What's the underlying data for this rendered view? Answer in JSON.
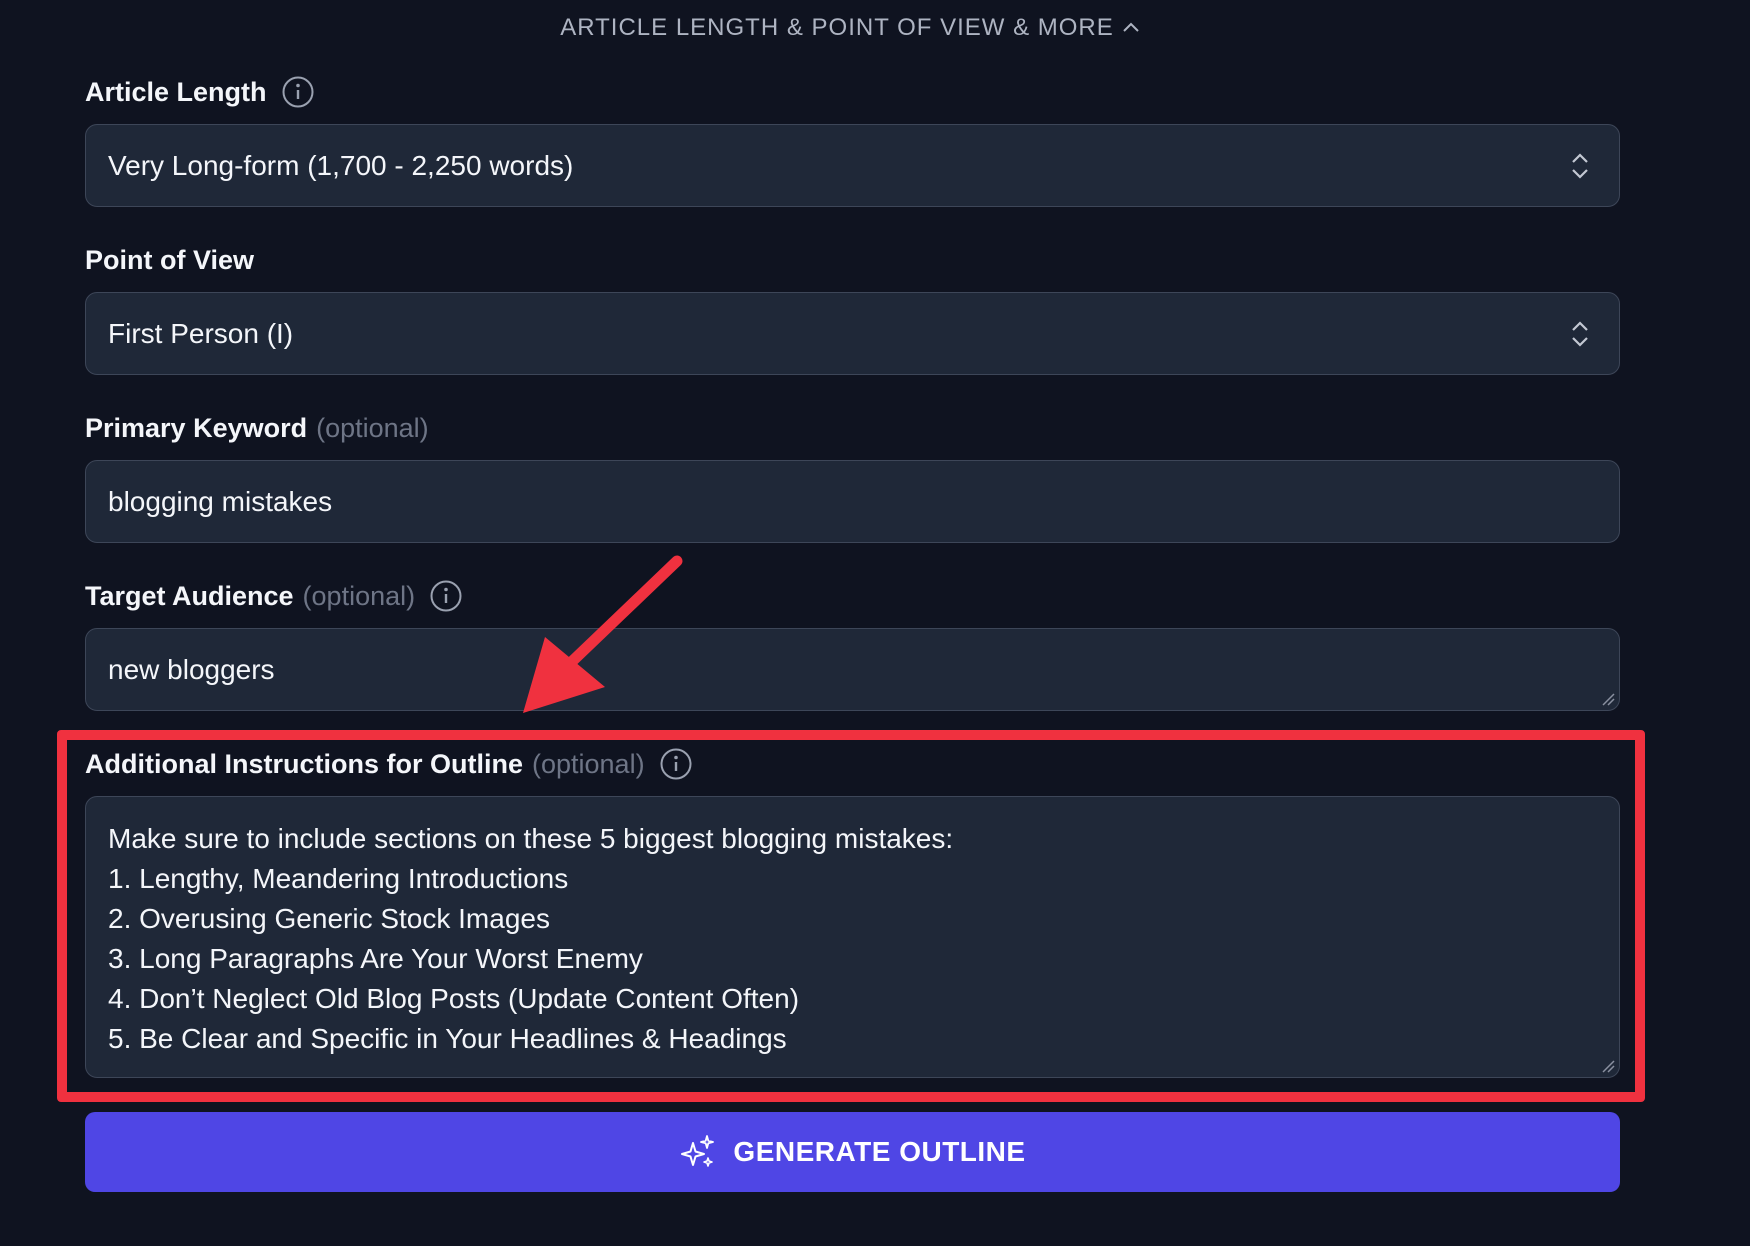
{
  "section": {
    "toggle_label": "ARTICLE LENGTH & POINT OF VIEW & MORE"
  },
  "article_length": {
    "label": "Article Length",
    "value": "Very Long-form (1,700 - 2,250 words)"
  },
  "point_of_view": {
    "label": "Point of View",
    "value": "First Person (I)"
  },
  "primary_keyword": {
    "label": "Primary Keyword",
    "optional": "(optional)",
    "value": "blogging mistakes"
  },
  "target_audience": {
    "label": "Target Audience",
    "optional": "(optional)",
    "value": "new bloggers"
  },
  "additional_instructions": {
    "label": "Additional Instructions for Outline",
    "optional": "(optional)",
    "lines": [
      "Make sure to include sections on these 5 biggest blogging mistakes:",
      "1. Lengthy, Meandering Introductions",
      "2. Overusing Generic Stock Images",
      "3. Long Paragraphs Are Your Worst Enemy",
      "4. Don’t Neglect Old Blog Posts (Update Content Often)",
      "5. Be Clear and Specific in Your Headlines & Headings"
    ]
  },
  "generate_button": {
    "label": "GENERATE OUTLINE"
  },
  "colors": {
    "background": "#0f1320",
    "field_bg": "#1f2838",
    "field_border": "#3d4658",
    "accent": "#4f46e5",
    "highlight": "#f0313f"
  }
}
